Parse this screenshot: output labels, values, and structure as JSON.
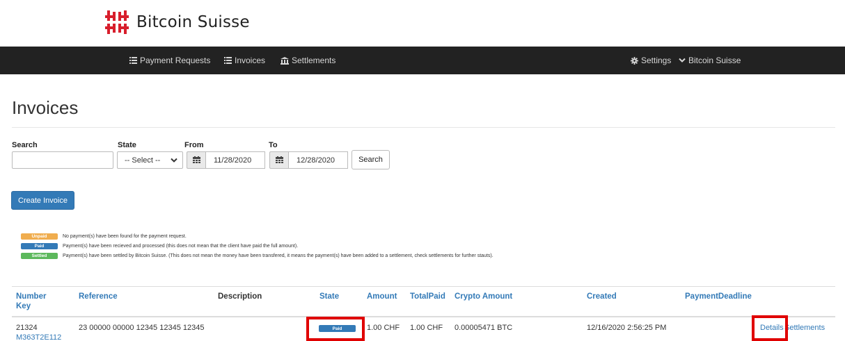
{
  "brand": {
    "name": "Bitcoin Suisse",
    "logo_color": "#d81e2c"
  },
  "navbar": {
    "left_items": [
      {
        "label": "Payment Requests",
        "icon": "list-icon"
      },
      {
        "label": "Invoices",
        "icon": "list-icon"
      },
      {
        "label": "Settlements",
        "icon": "bank-icon"
      }
    ],
    "right_items": [
      {
        "label": "Settings",
        "icon": "gear-icon"
      },
      {
        "label": "Bitcoin Suisse",
        "icon": "chevron-down-icon"
      }
    ]
  },
  "page": {
    "title": "Invoices"
  },
  "filters": {
    "search_label": "Search",
    "search_value": "",
    "state_label": "State",
    "state_value": "-- Select --",
    "from_label": "From",
    "from_value": "11/28/2020",
    "to_label": "To",
    "to_value": "12/28/2020",
    "search_button": "Search"
  },
  "create_button": "Create Invoice",
  "legend": [
    {
      "badge": "Unpaid",
      "color": "#f0ad4e",
      "text": "No payment(s) have been found for the payment request."
    },
    {
      "badge": "Paid",
      "color": "#337ab7",
      "text": "Payment(s) have been recieved and processed (this does not mean that the client have paid the full amount)."
    },
    {
      "badge": "Settled",
      "color": "#5cb85c",
      "text": "Payment(s) have been settled by Bitcoin Suisse. (This does not mean the money have been transfered, it means the payment(s) have been added to a settlement, check settlements for further stauts)."
    }
  ],
  "table": {
    "headers": {
      "number": "Number",
      "key": "Key",
      "reference": "Reference",
      "description": "Description",
      "state": "State",
      "amount": "Amount",
      "total_paid": "TotalPaid",
      "crypto_amount": "Crypto Amount",
      "created": "Created",
      "payment_deadline": "PaymentDeadline"
    },
    "rows": [
      {
        "number": "21324",
        "key": "M363T2E112",
        "reference": "23 00000 00000 12345 12345 12345",
        "description": "",
        "state": "Paid",
        "amount": "1.00 CHF",
        "total_paid": "1.00 CHF",
        "crypto_amount": "0.00005471 BTC",
        "created": "12/16/2020 2:56:25 PM",
        "payment_deadline": "",
        "details_link": "Details",
        "settlements_link": "Settlements"
      }
    ]
  },
  "highlight_color": "#e00000"
}
